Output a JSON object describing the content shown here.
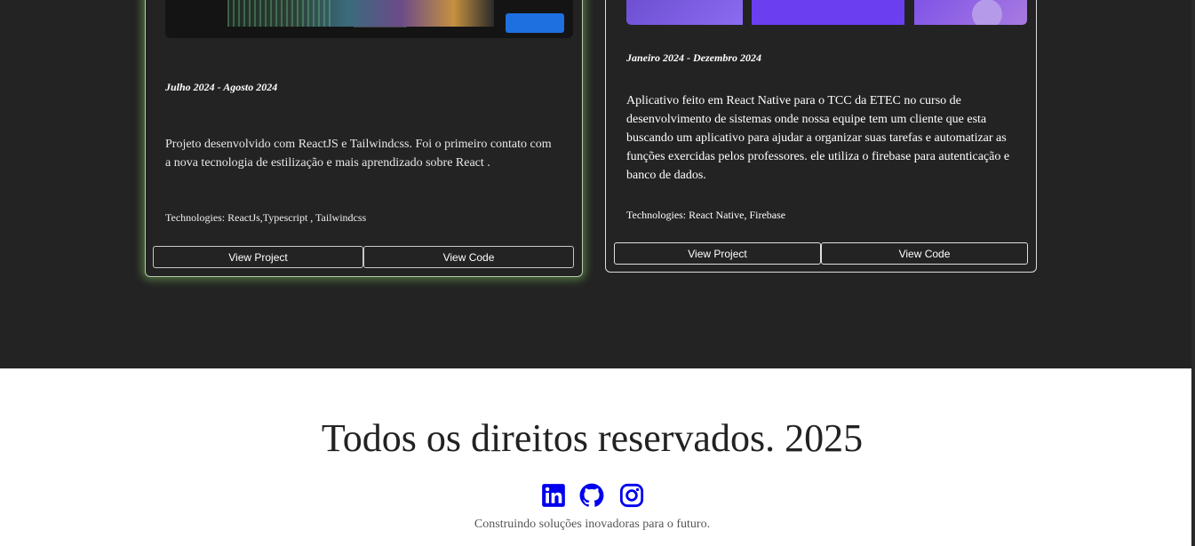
{
  "projects": [
    {
      "date": "Julho 2024 - Agosto 2024",
      "description": "Projeto desenvolvido com ReactJS e Tailwindcss. Foi o primeiro contato com a nova tecnologia de estilização e mais aprendizado sobre React .",
      "technologies": "Technologies: ReactJs,Typescript , Tailwindcss",
      "view_project_label": "View Project",
      "view_code_label": "View Code"
    },
    {
      "date": "Janeiro 2024 - Dezembro 2024",
      "description": "Aplicativo feito em React Native para o TCC da ETEC no curso de desenvolvimento de sistemas onde nossa equipe tem um cliente que esta buscando um aplicativo para ajudar a organizar suas tarefas e automatizar as funções exercidas pelos professores. ele utiliza o firebase para autenticação e banco de dados.",
      "technologies": "Technologies: React Native, Firebase",
      "view_project_label": "View Project",
      "view_code_label": "View Code"
    }
  ],
  "footer": {
    "title": "Todos os direitos reservados. 2025",
    "tagline": "Construindo soluções inovadoras para o futuro.",
    "icon_color": "#0000ee",
    "socials": [
      {
        "icon": "linkedin-icon"
      },
      {
        "icon": "github-icon"
      },
      {
        "icon": "instagram-icon"
      }
    ]
  },
  "colors": {
    "background_dark": "#232323",
    "card_glow": "#78be5a",
    "footer_background": "#ffffff"
  }
}
